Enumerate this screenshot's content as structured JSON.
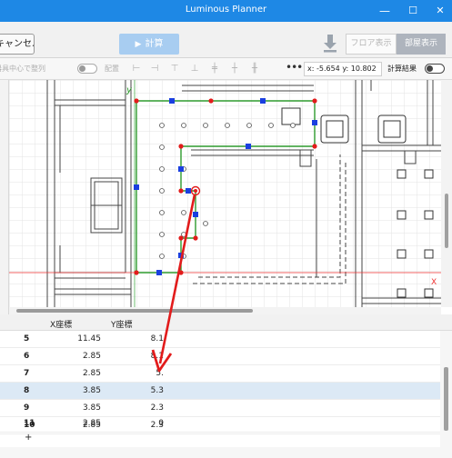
{
  "window": {
    "title": "Luminous Planner",
    "minimize": "—",
    "maximize": "☐",
    "close": "✕"
  },
  "toolbar": {
    "cancel_label": "キャンセル",
    "calculate_label": "計算",
    "floor_view_label": "フロア表示",
    "room_view_label": "部屋表示"
  },
  "subtoolbar": {
    "center_align_label": "器具中心で整列",
    "arrange_label": "配置",
    "coord_x_label": "x:",
    "coord_x_value": "-5.654",
    "coord_y_label": "y:",
    "coord_y_value": "10.802",
    "calc_result_label": "計算結果"
  },
  "canvas": {
    "y_axis_label": "y",
    "x_axis_label": "X"
  },
  "table": {
    "headers": [
      "X座標",
      "Y座標"
    ],
    "rows": [
      {
        "idx": "5",
        "x": "11.45",
        "y": "8.1",
        "selected": false
      },
      {
        "idx": "6",
        "x": "2.85",
        "y": "8.1",
        "selected": false
      },
      {
        "idx": "7",
        "x": "2.85",
        "y": "5.",
        "selected": false
      },
      {
        "idx": "8",
        "x": "3.85",
        "y": "5.3",
        "selected": true
      },
      {
        "idx": "9",
        "x": "3.85",
        "y": "2.3",
        "selected": false
      },
      {
        "idx": "10",
        "x": "2.85",
        "y": "2.3",
        "selected": false
      },
      {
        "idx": "11",
        "x": "2.85",
        "y": "0",
        "selected": false
      }
    ],
    "add_row": "+"
  },
  "colors": {
    "title_bar": "#1e88e5",
    "room_outline": "#2e9b2e",
    "vertex": "#e21b1b",
    "midpoint": "#1a3fe0",
    "annotation": "#e21b1b"
  }
}
